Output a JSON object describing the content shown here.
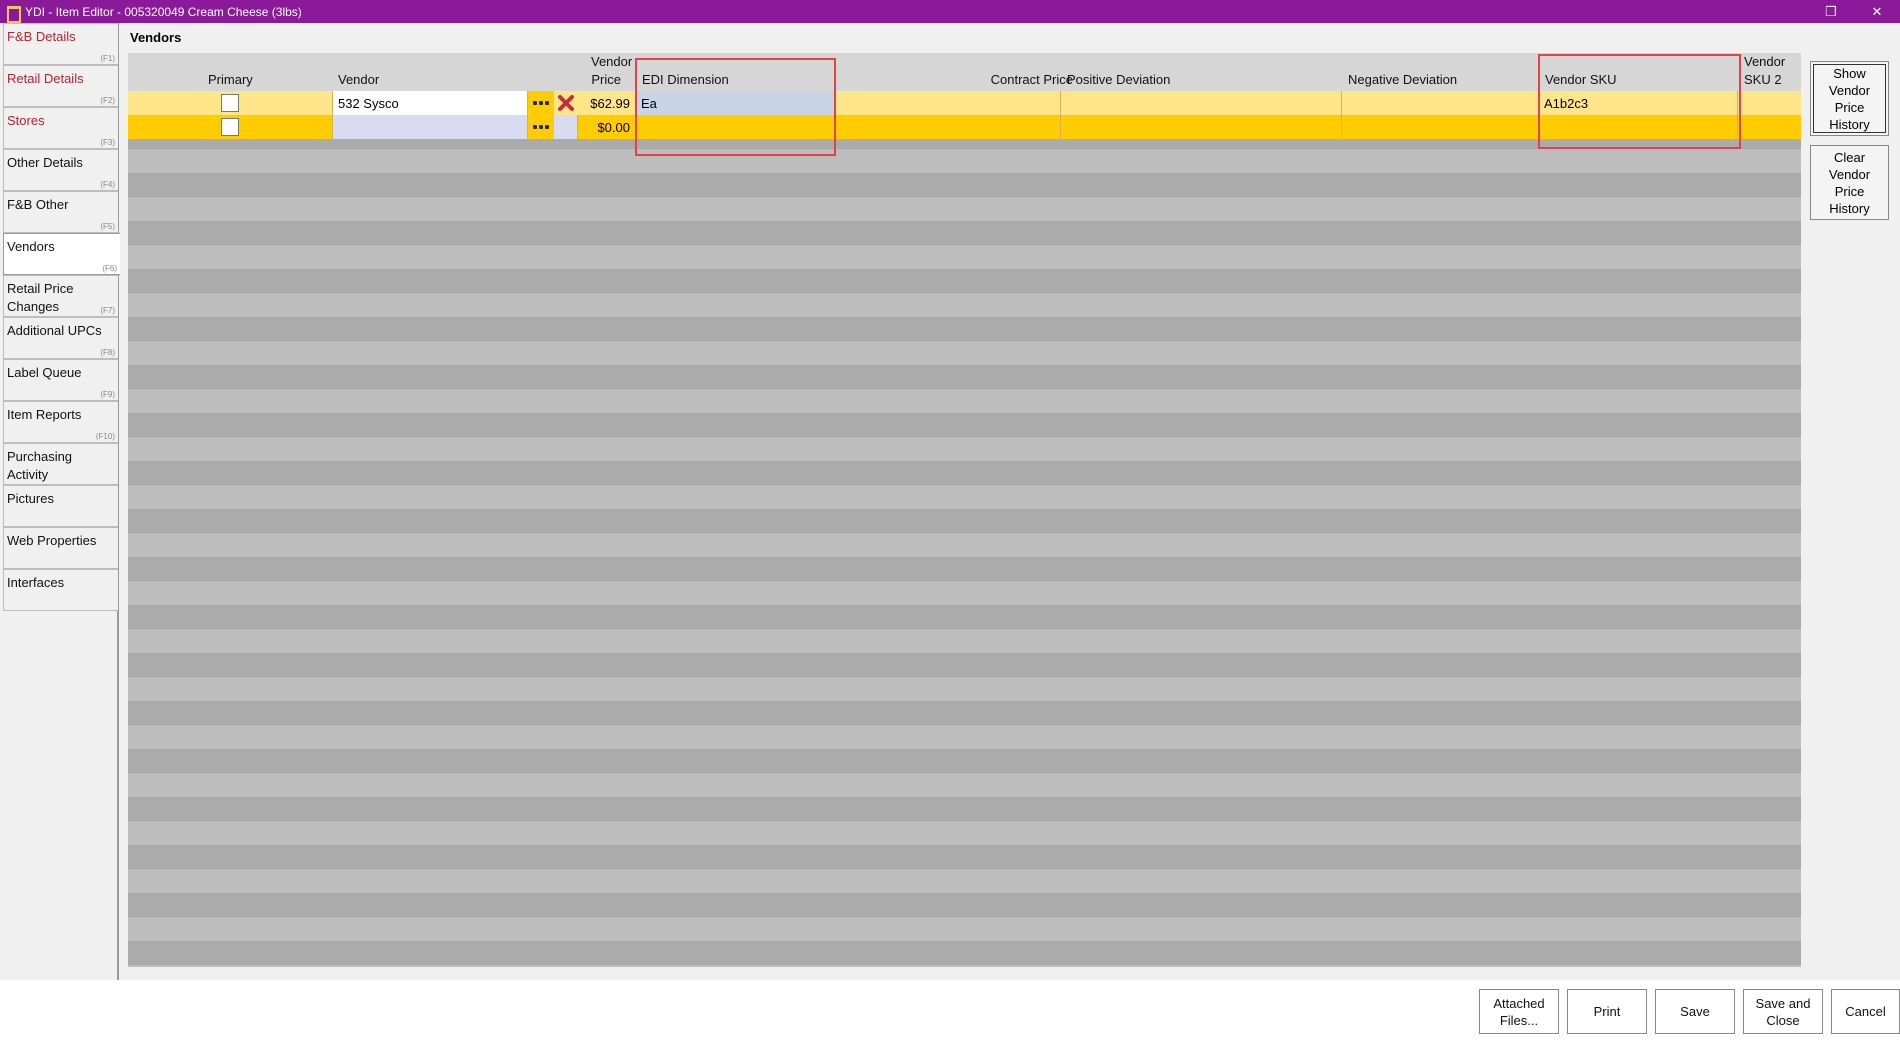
{
  "window": {
    "title": "YDI - Item Editor - 005320049 Cream Cheese (3lbs)",
    "restore_glyph": "❐",
    "close_glyph": "✕"
  },
  "sidebar": {
    "tabs": [
      {
        "label": "F&B Details",
        "fkey": "(F1)"
      },
      {
        "label": "Retail Details",
        "fkey": "(F2)"
      },
      {
        "label": "Stores",
        "fkey": "(F3)"
      },
      {
        "label": "Other Details",
        "fkey": "(F4)"
      },
      {
        "label": "F&B Other",
        "fkey": "(F5)"
      },
      {
        "label": "Vendors",
        "fkey": "(F6)"
      },
      {
        "label": "Retail Price Changes",
        "fkey": "(F7)"
      },
      {
        "label": "Additional UPCs",
        "fkey": "(F8)"
      },
      {
        "label": "Label Queue",
        "fkey": "(F9)"
      },
      {
        "label": "Item Reports",
        "fkey": "(F10)"
      },
      {
        "label": "Purchasing Activity",
        "fkey": ""
      },
      {
        "label": "Pictures",
        "fkey": ""
      },
      {
        "label": "Web Properties",
        "fkey": ""
      },
      {
        "label": "Interfaces",
        "fkey": ""
      }
    ]
  },
  "main": {
    "section_title": "Vendors",
    "columns": {
      "primary": "Primary",
      "vendor": "Vendor",
      "vendor_price_line1": "Vendor",
      "vendor_price_line2": "Price",
      "edi_dimension": "EDI Dimension",
      "contract_price": "Contract Price",
      "positive_deviation": "Positive Deviation",
      "negative_deviation": "Negative Deviation",
      "vendor_sku": "Vendor SKU",
      "vendor_sku2_line1": "Vendor",
      "vendor_sku2_line2": "SKU 2"
    },
    "rows": [
      {
        "primary": false,
        "vendor": "532 Sysco",
        "vendor_price": "$62.99",
        "edi_dimension": "Ea",
        "contract_price": "",
        "positive_deviation": "",
        "negative_deviation": "",
        "vendor_sku": "A1b2c3",
        "vendor_sku2": ""
      },
      {
        "primary": false,
        "vendor": "",
        "vendor_price": "$0.00",
        "edi_dimension": "",
        "contract_price": "",
        "positive_deviation": "",
        "negative_deviation": "",
        "vendor_sku": "",
        "vendor_sku2": ""
      }
    ]
  },
  "right_buttons": {
    "show_history": "Show Vendor Price History",
    "clear_history": "Clear Vendor Price History"
  },
  "bottom_buttons": {
    "attached_files": "Attached Files...",
    "print": "Print",
    "save": "Save",
    "save_and_close": "Save and Close",
    "cancel": "Cancel"
  },
  "colors": {
    "titlebar": "#8b1a9a",
    "row_selected": "#ffe58a",
    "row_new": "#ffcc00",
    "highlight_box": "#e04545",
    "red_tab_label": "#b5242f"
  },
  "icons": {
    "app": "app-logo-icon",
    "vendor_lookup": "ellipsis-icon",
    "delete_row": "red-x-delete-icon"
  }
}
